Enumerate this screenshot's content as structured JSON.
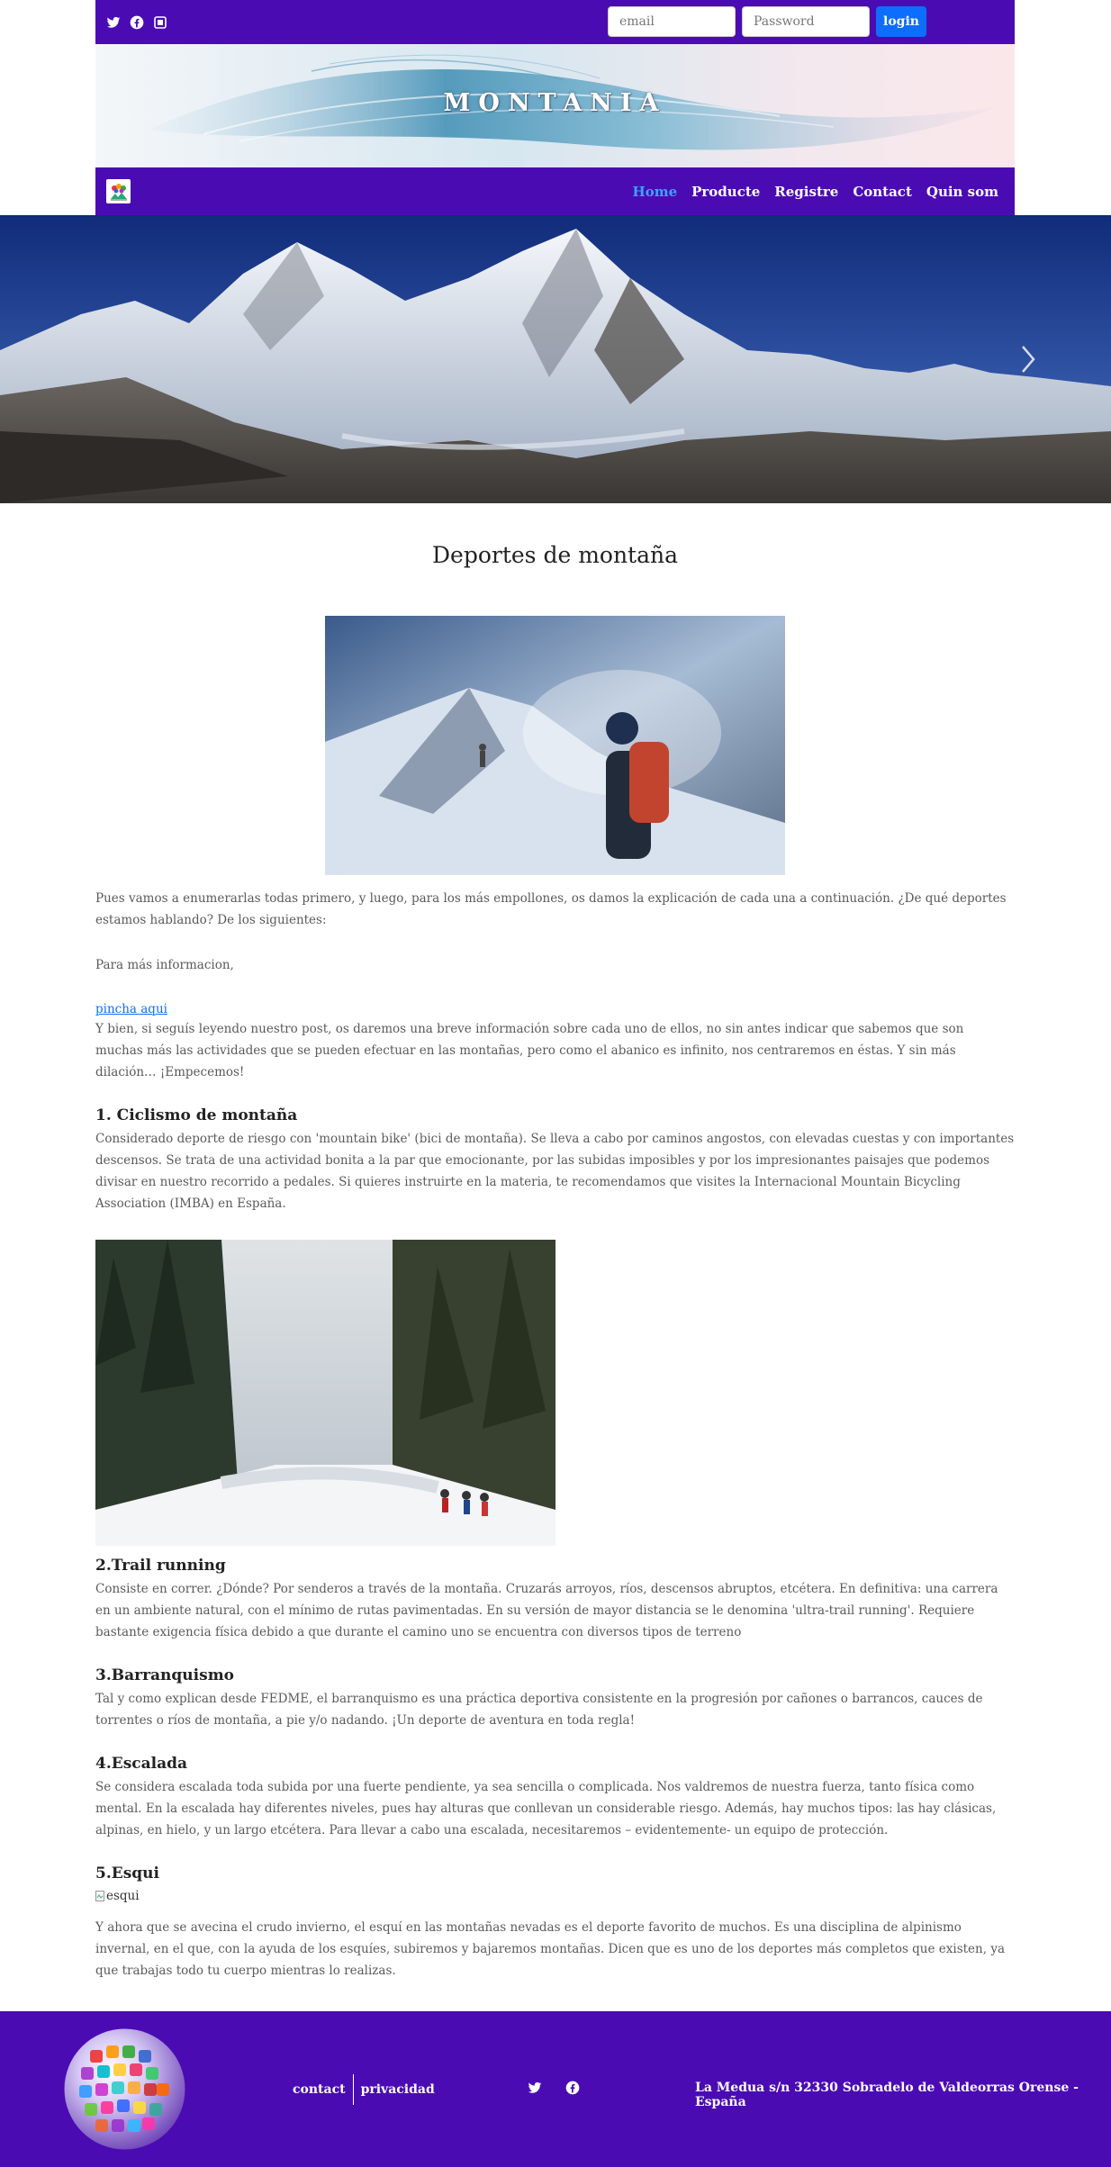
{
  "topbar": {
    "social_icons": [
      "twitter-icon",
      "facebook-icon",
      "instagram-icon"
    ],
    "email_placeholder": "email",
    "password_placeholder": "Password",
    "login_label": "login"
  },
  "banner": {
    "title": "MONTANIA"
  },
  "nav": {
    "items": [
      {
        "label": "Home",
        "active": true
      },
      {
        "label": "Producte",
        "active": false
      },
      {
        "label": "Registre",
        "active": false
      },
      {
        "label": "Contact",
        "active": false
      },
      {
        "label": "Quin som",
        "active": false
      }
    ]
  },
  "main": {
    "title": "Deportes de montaña",
    "intro": "Pues vamos a enumerarlas todas primero, y luego, para los más empollones, os damos la explicación de cada una a continuación. ¿De qué deportes estamos hablando? De los siguientes:",
    "more_info": "Para más informacion,",
    "link_text": "pincha aqui",
    "after_link": "Y bien, si seguís leyendo nuestro post, os daremos una breve información sobre cada uno de ellos, no sin antes indicar que sabemos que son muchas más las actividades que se pueden efectuar en las montañas, pero como el abanico es infinito, nos centraremos en éstas. Y sin más dilación… ¡Empecemos!",
    "sections": [
      {
        "heading": "1. Ciclismo de montaña",
        "text": "Considerado deporte de riesgo con 'mountain bike' (bici de montaña). Se lleva a cabo por caminos angostos, con elevadas cuestas y con importantes descensos. Se trata de una actividad bonita a la par que emocionante, por las subidas imposibles y por los impresionantes paisajes que podemos divisar en nuestro recorrido a pedales. Si quieres instruirte en la materia, te recomendamos que visites la Internacional Mountain Bicycling Association (IMBA) en España."
      },
      {
        "heading": "2.Trail running",
        "text": "Consiste en correr. ¿Dónde? Por senderos a través de la montaña. Cruzarás arroyos, ríos, descensos abruptos, etcétera. En definitiva: una carrera en un ambiente natural, con el mínimo de rutas pavimentadas. En su versión de mayor distancia se le denomina 'ultra-trail running'. Requiere bastante exigencia física debido a que durante el camino uno se encuentra con diversos tipos de terreno"
      },
      {
        "heading": "3.Barranquismo",
        "text": "Tal y como explican desde FEDME, el barranquismo es una práctica deportiva consistente en la progresión por cañones o barrancos, cauces de torrentes o ríos de montaña, a pie y/o nadando. ¡Un deporte de aventura en toda regla!"
      },
      {
        "heading": "4.Escalada",
        "text": "Se considera escalada toda subida por una fuerte pendiente, ya sea sencilla o complicada. Nos valdremos de nuestra fuerza, tanto física como mental. En la escalada hay diferentes niveles, pues hay alturas que conllevan un considerable riesgo. Además, hay muchos tipos: las hay clásicas, alpinas, en hielo, y un largo etcétera. Para llevar a cabo una escalada, necesitaremos – evidentemente- un equipo de protección."
      },
      {
        "heading": "5.Esqui",
        "image_alt": "esqui",
        "text": "Y ahora que se avecina el crudo invierno, el esquí en las montañas nevadas es el deporte favorito de muchos. Es una disciplina de alpinismo invernal, en el que, con la ayuda de los esquíes, subiremos y bajaremos montañas. Dicen que es uno de los deportes más completos que existen, ya que trabajas todo tu cuerpo mientras lo realizas."
      }
    ]
  },
  "footer": {
    "contact": "contact",
    "privacy": "privacidad",
    "social_icons": [
      "twitter-icon",
      "facebook-icon"
    ],
    "address": "La Medua s/n 32330 Sobradelo de Valdeorras Orense - España"
  },
  "colors": {
    "brand_purple": "#4b0bb3",
    "link_blue": "#0d6efd",
    "active_nav": "#3ea2ff"
  }
}
